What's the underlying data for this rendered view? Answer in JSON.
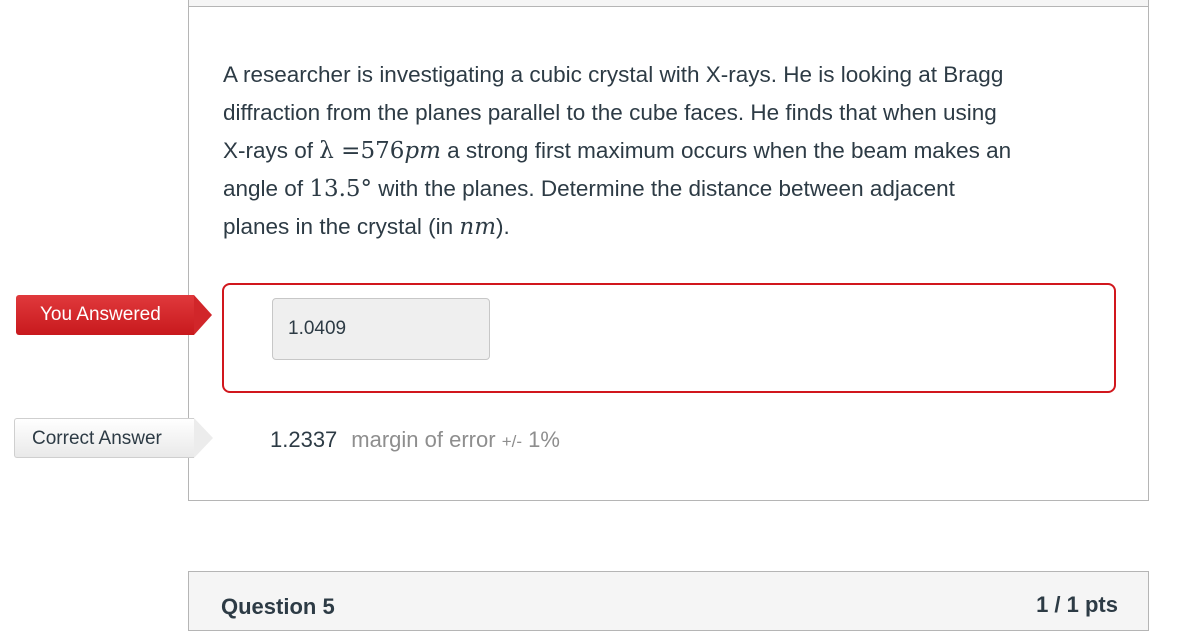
{
  "question": {
    "line1": "A researcher is investigating a cubic crystal with X-rays. He is looking at Bragg",
    "line2": "diffraction from the planes parallel to the cube  faces. He finds that when using",
    "line3_pre": "X-rays of ",
    "line3_math_lambda": "λ",
    "line3_math_eq": " =576",
    "line3_math_unit": "pm",
    "line3_post": "  a strong first maximum occurs when the beam makes an",
    "line4_pre": "angle of  ",
    "line4_math": "13.5°",
    "line4_post": "  with the planes.  Determine the distance between adjacent",
    "line5_pre": "planes in the crystal  (in ",
    "line5_math_unit": "nm",
    "line5_post": ")."
  },
  "you_answered": {
    "label": "You Answered",
    "value": "1.0409",
    "status_color": "#d1171d"
  },
  "correct_answer": {
    "label": "Correct Answer",
    "value": "1.2337",
    "margin_prefix": "margin of error ",
    "margin_symbol": "+/-",
    "margin_value": " 1%"
  },
  "next_question": {
    "title": "Question 5",
    "points": "1 / 1 pts"
  }
}
